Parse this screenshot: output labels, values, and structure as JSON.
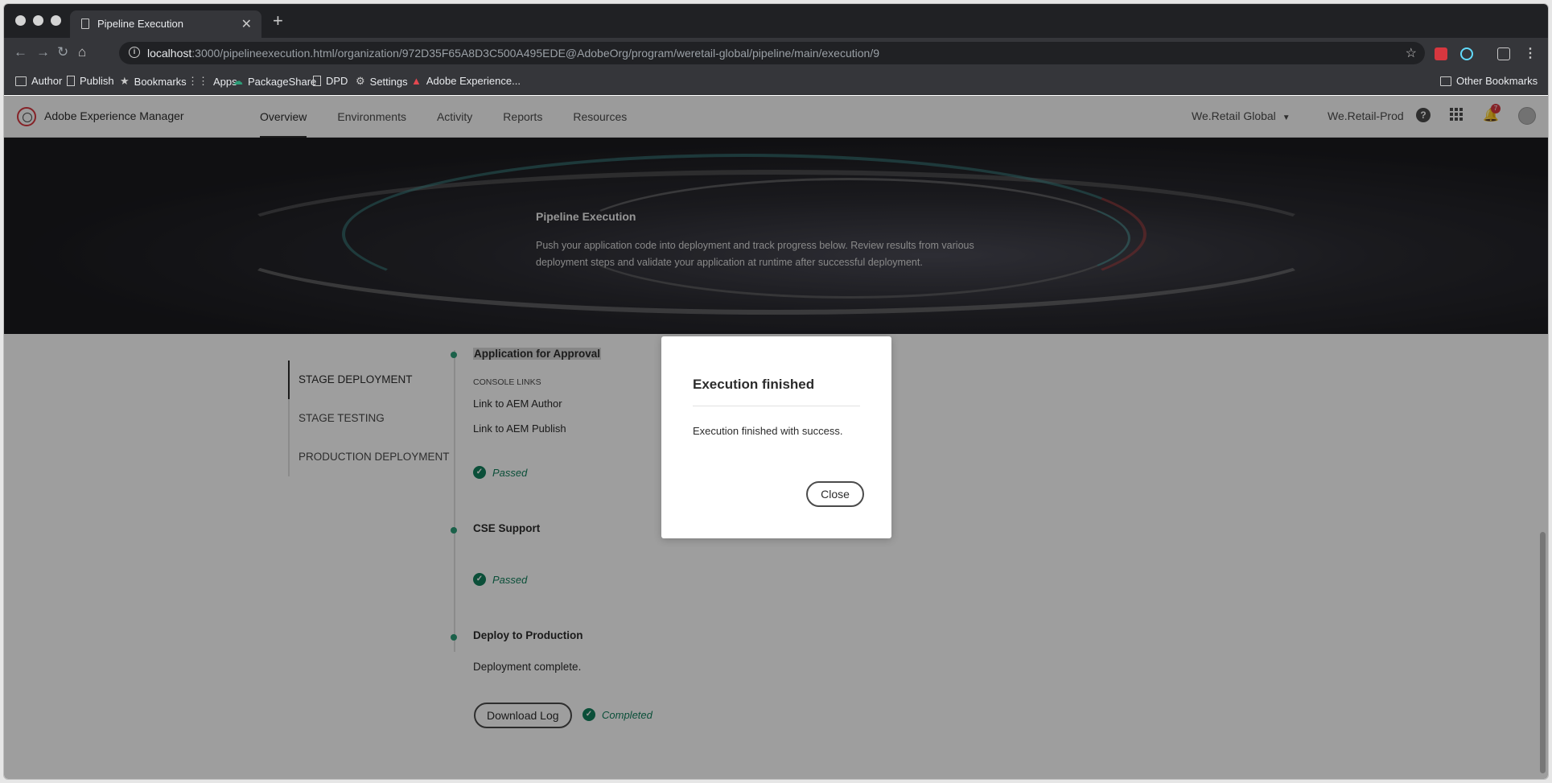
{
  "browser": {
    "tab_title": "Pipeline Execution",
    "url_host": "localhost",
    "url_rest": ":3000/pipelineexecution.html/organization/972D35F65A8D3C500A495EDE@AdobeOrg/program/weretail-global/pipeline/main/execution/9",
    "bookmarks": [
      "Author",
      "Publish",
      "Bookmarks",
      "Apps",
      "PackageShare",
      "DPD",
      "Settings",
      "Adobe Experience..."
    ],
    "other_bookmarks": "Other Bookmarks"
  },
  "aem": {
    "brand": "Adobe Experience Manager",
    "tabs": [
      "Overview",
      "Environments",
      "Activity",
      "Reports",
      "Resources"
    ],
    "org": "We.Retail Global",
    "program": "We.Retail-Prod",
    "notifications": "7"
  },
  "hero": {
    "title": "Pipeline Execution",
    "description": "Push your application code into deployment and track progress below. Review results from various deployment steps and validate your application at runtime after successful deployment."
  },
  "steps": [
    "STAGE DEPLOYMENT",
    "STAGE TESTING",
    "PRODUCTION DEPLOYMENT"
  ],
  "timeline": {
    "approval": {
      "title": "Application for Approval",
      "console_links": "CONSOLE LINKS",
      "link_author": "Link to AEM Author",
      "link_publish": "Link to AEM Publish",
      "status": "Passed"
    },
    "cse": {
      "title": "CSE Support",
      "status": "Passed"
    },
    "deploy": {
      "title": "Deploy to Production",
      "text": "Deployment complete.",
      "button": "Download Log",
      "status": "Completed"
    }
  },
  "dialog": {
    "title": "Execution finished",
    "body": "Execution finished with success.",
    "close": "Close"
  }
}
